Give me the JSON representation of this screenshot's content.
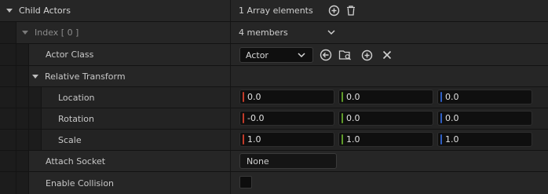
{
  "child_actors": {
    "label": "Child Actors",
    "value": "1 Array elements",
    "add_icon": "plus-circle-icon",
    "delete_icon": "trash-icon"
  },
  "index": {
    "label": "Index [ 0 ]",
    "value": "4 members"
  },
  "actor_class": {
    "label": "Actor Class",
    "selected": "Actor",
    "icons": [
      "use-selected-arrow-icon",
      "browse-folder-icon",
      "plus-circle-icon",
      "clear-x-icon"
    ]
  },
  "relative_transform": {
    "label": "Relative Transform"
  },
  "location": {
    "label": "Location",
    "x": "0.0",
    "y": "0.0",
    "z": "0.0"
  },
  "rotation": {
    "label": "Rotation",
    "x": "-0.0",
    "y": "0.0",
    "z": "0.0"
  },
  "scale": {
    "label": "Scale",
    "x": "1.0",
    "y": "1.0",
    "z": "1.0"
  },
  "attach_socket": {
    "label": "Attach Socket",
    "value": "None"
  },
  "enable_collision": {
    "label": "Enable Collision",
    "checked": false
  },
  "colors": {
    "axis_x": "#c23b2a",
    "axis_y": "#5f9b2a",
    "axis_z": "#2f5fc4",
    "row_bg": "#262626",
    "field_bg": "#0f0f0f"
  }
}
